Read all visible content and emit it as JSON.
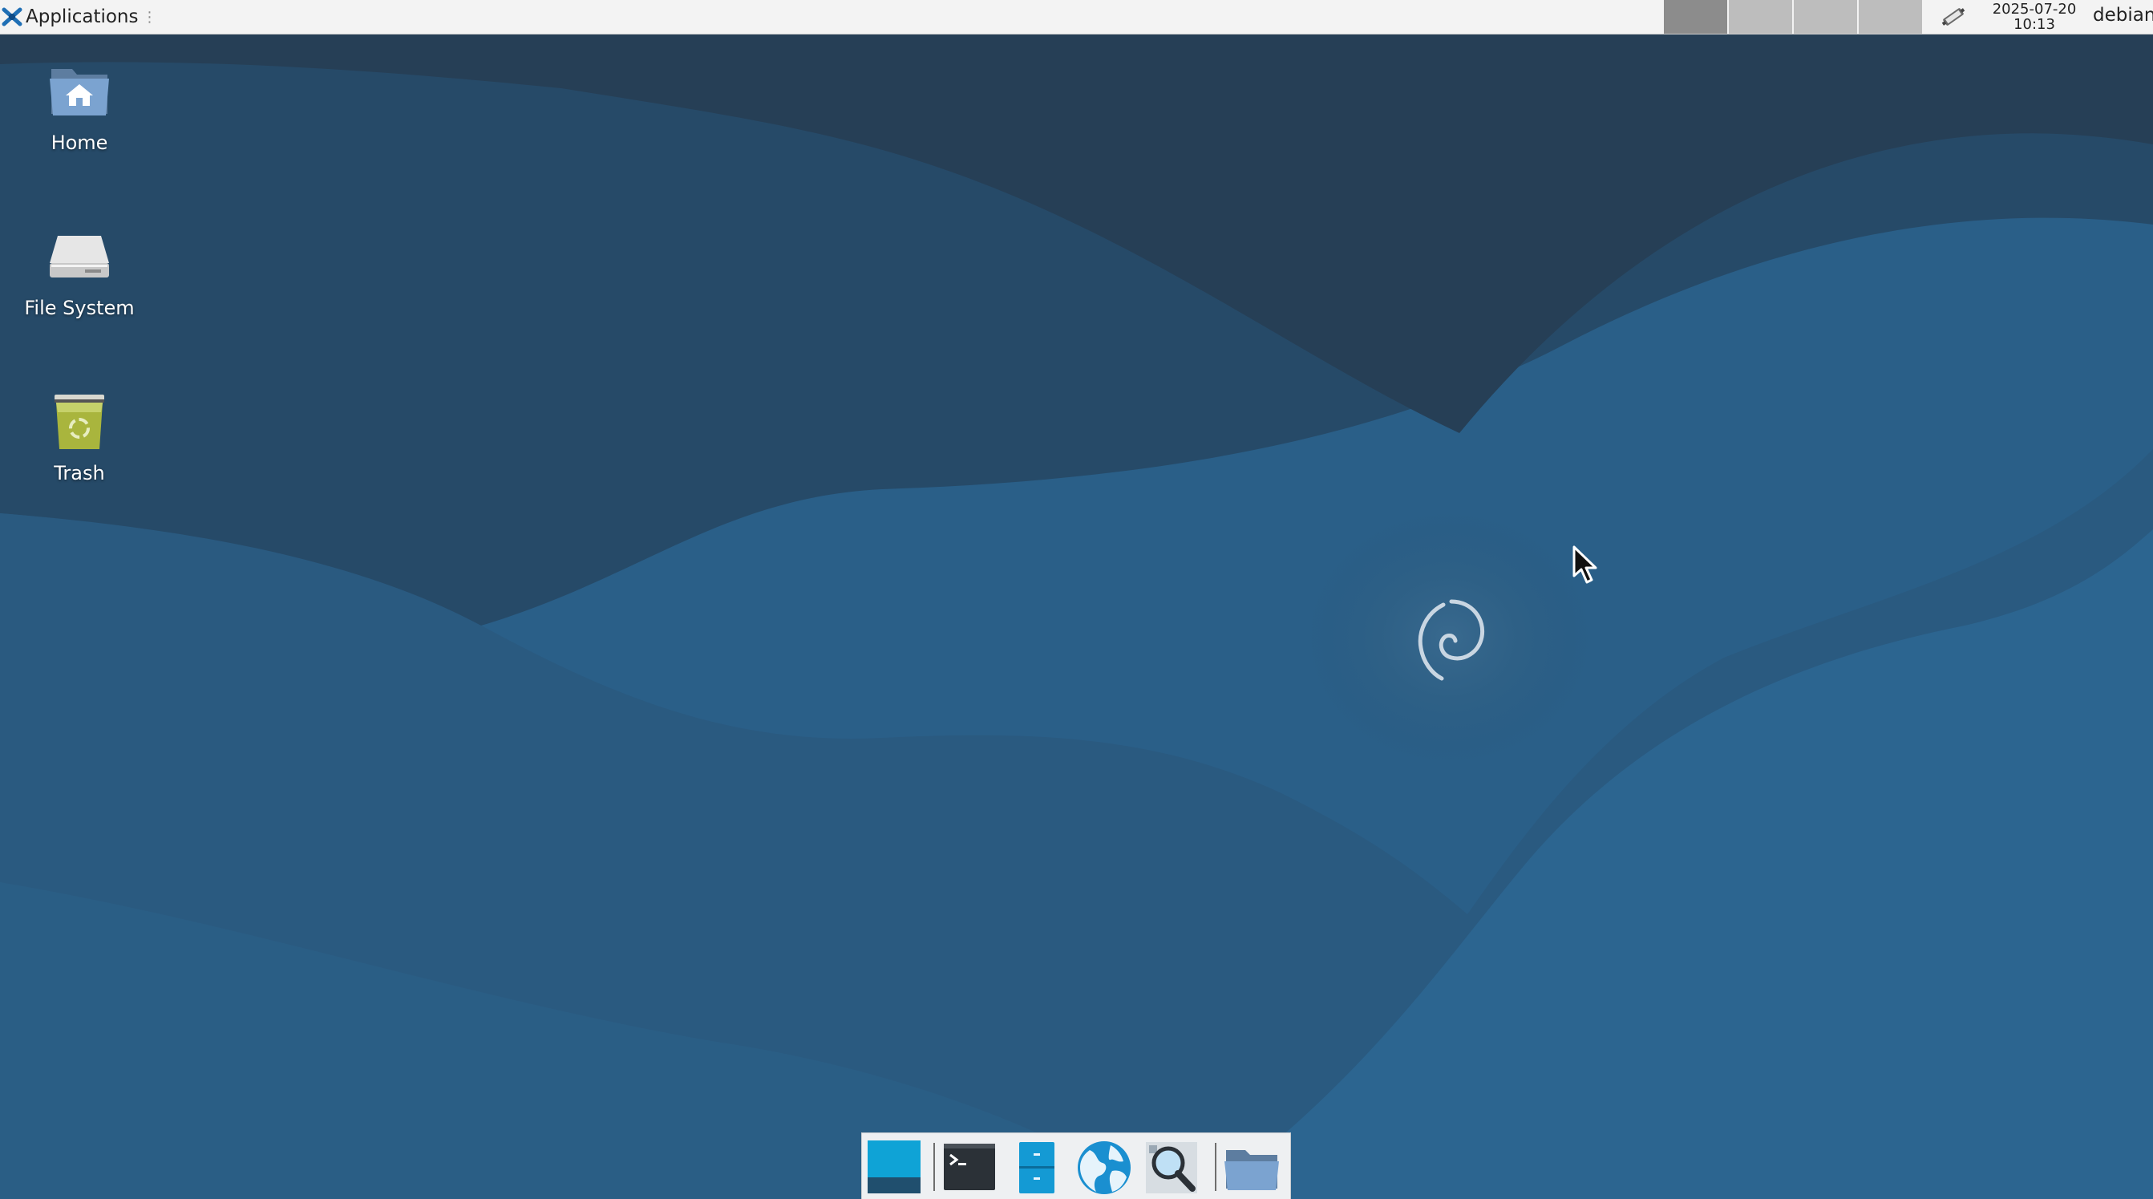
{
  "top_panel": {
    "applications_label": "Applications",
    "clock_date": "2025-07-20",
    "clock_time": "10:13",
    "user": "debian"
  },
  "workspaces": {
    "count": 4,
    "active_index": 0
  },
  "desktop_icons": [
    {
      "label": "Home",
      "icon": "home-folder-icon"
    },
    {
      "label": "File System",
      "icon": "drive-icon"
    },
    {
      "label": "Trash",
      "icon": "trash-icon"
    }
  ],
  "dock": {
    "items": [
      {
        "name": "show-desktop",
        "icon": "show-desktop-icon"
      },
      {
        "name": "terminal",
        "icon": "terminal-icon"
      },
      {
        "name": "file-manager",
        "icon": "file-manager-icon"
      },
      {
        "name": "web-browser",
        "icon": "web-browser-icon"
      },
      {
        "name": "app-finder",
        "icon": "search-icon"
      },
      {
        "name": "folder",
        "icon": "folder-icon"
      }
    ]
  },
  "colors": {
    "wallpaper_base": "#2a5d86",
    "wallpaper_dark": "#25405a",
    "panel_bg": "#f3f3f3",
    "dock_bg": "#eef0f2"
  }
}
